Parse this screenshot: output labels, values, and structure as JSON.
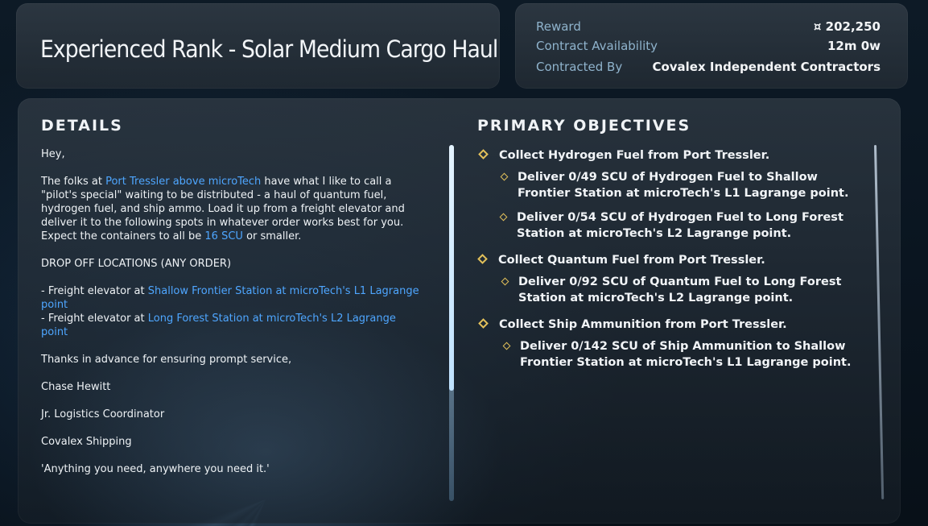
{
  "contract": {
    "title": "Experienced Rank - Solar Medium Cargo Haul"
  },
  "info": {
    "reward_label": "Reward",
    "reward_value": "¤ 202,250",
    "availability_label": "Contract Availability",
    "availability_value": "12m 0w",
    "contracted_by_label": "Contracted By",
    "contracted_by_value": "Covalex Independent Contractors"
  },
  "details": {
    "heading": "DETAILS",
    "greeting": "Hey,",
    "p1_a": "The folks at ",
    "p1_link": "Port Tressler above microTech",
    "p1_b": " have what I like to call a \"pilot's special\" waiting to be distributed - a haul of quantum fuel, hydrogen fuel, and ship ammo. Load it up from a freight elevator and deliver it to the following spots in whatever order works best for you. Expect the containers to all be ",
    "p1_link2": "16 SCU",
    "p1_c": " or smaller.",
    "dropoff_heading": "DROP OFF LOCATIONS (ANY ORDER)",
    "loc1_prefix": "- Freight elevator at ",
    "loc1_link": "Shallow Frontier Station at microTech's L1 Lagrange point",
    "loc2_prefix": "- Freight elevator at ",
    "loc2_link": "Long Forest Station at microTech's L2 Lagrange point",
    "thanks": "Thanks in advance for ensuring prompt service,",
    "sig_name": "Chase Hewitt",
    "sig_title": "Jr. Logistics Coordinator",
    "sig_company": "Covalex Shipping",
    "sig_motto": "'Anything you need, anywhere you need it.'"
  },
  "objectives": {
    "heading": "PRIMARY OBJECTIVES",
    "items": [
      {
        "text": "Collect Hydrogen Fuel from Port Tressler."
      },
      {
        "text": "Deliver 0/49 SCU of Hydrogen Fuel to Shallow Frontier Station at microTech's L1 Lagrange point."
      },
      {
        "text": "Deliver 0/54 SCU of Hydrogen Fuel to Long Forest Station at microTech's L2 Lagrange point."
      },
      {
        "text": "Collect Quantum Fuel from Port Tressler."
      },
      {
        "text": "Deliver 0/92 SCU of Quantum Fuel to Long Forest Station at microTech's L2 Lagrange point."
      },
      {
        "text": "Collect Ship Ammunition from Port Tressler."
      },
      {
        "text": "Deliver 0/142 SCU of Ship Ammunition to Shallow Frontier Station at microTech's L1 Lagrange point."
      }
    ]
  },
  "colors": {
    "accent_link": "#4ea6ff",
    "objective_marker": "#e2c05a",
    "label": "#8fb3cc"
  },
  "icons": {
    "objective_marker": "diamond-icon"
  }
}
